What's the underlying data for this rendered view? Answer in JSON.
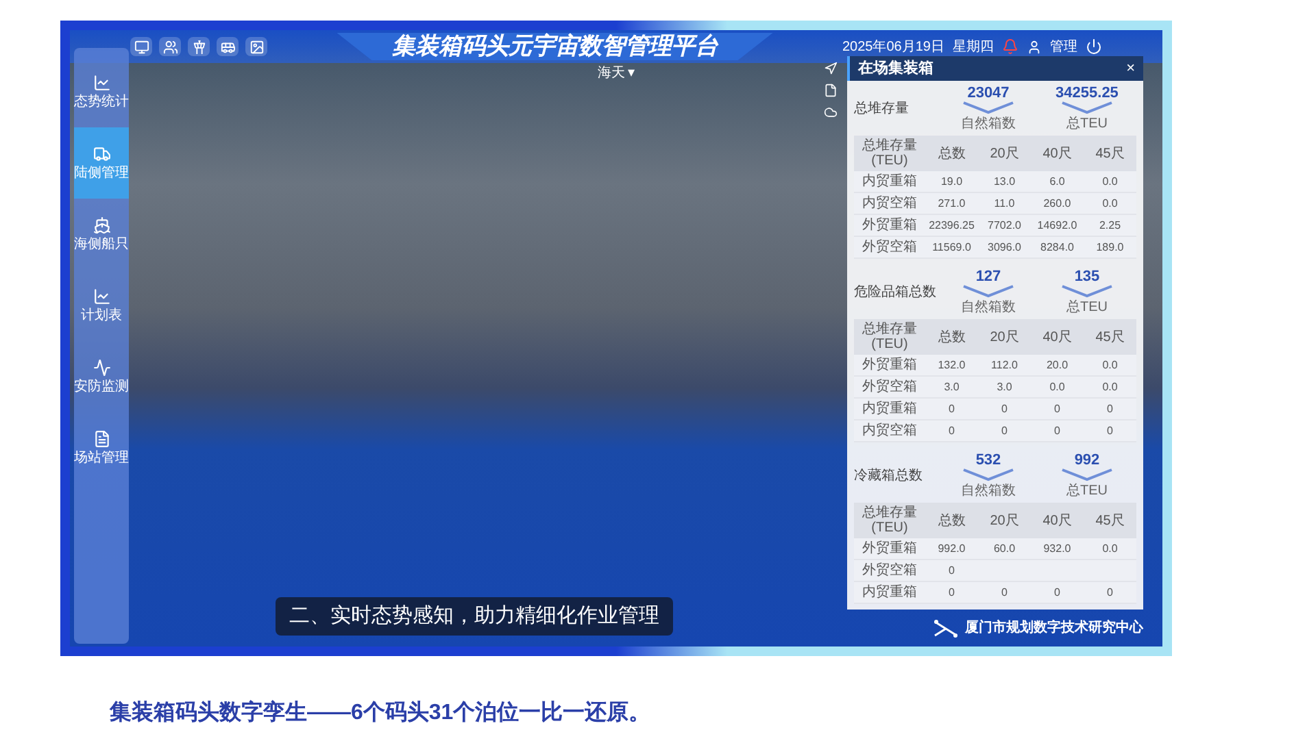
{
  "header": {
    "title": "集装箱码头元宇宙数智管理平台",
    "location": "海天",
    "location_caret": "▾",
    "date": "2025年06月19日",
    "weekday": "星期四",
    "user": "管理"
  },
  "sidebar": {
    "items": [
      {
        "label": "态势统计",
        "selected": false
      },
      {
        "label": "陆侧管理",
        "selected": true
      },
      {
        "label": "海侧船只",
        "selected": false
      },
      {
        "label": "计划表",
        "selected": false
      },
      {
        "label": "安防监测",
        "selected": false
      },
      {
        "label": "场站管理",
        "selected": false
      }
    ]
  },
  "panel": {
    "title": "在场集装箱",
    "close": "×",
    "sections": [
      {
        "label": "总堆存量",
        "stats": [
          {
            "value": "23047",
            "caption": "自然箱数"
          },
          {
            "value": "34255.25",
            "caption": "总TEU"
          }
        ],
        "columns": [
          "总堆存量 (TEU)",
          "总数",
          "20尺",
          "40尺",
          "45尺"
        ],
        "rows": [
          [
            "内贸重箱",
            "19.0",
            "13.0",
            "6.0",
            "0.0"
          ],
          [
            "内贸空箱",
            "271.0",
            "11.0",
            "260.0",
            "0.0"
          ],
          [
            "外贸重箱",
            "22396.25",
            "7702.0",
            "14692.0",
            "2.25"
          ],
          [
            "外贸空箱",
            "11569.0",
            "3096.0",
            "8284.0",
            "189.0"
          ]
        ]
      },
      {
        "label": "危险品箱总数",
        "stats": [
          {
            "value": "127",
            "caption": "自然箱数"
          },
          {
            "value": "135",
            "caption": "总TEU"
          }
        ],
        "columns": [
          "总堆存量 (TEU)",
          "总数",
          "20尺",
          "40尺",
          "45尺"
        ],
        "rows": [
          [
            "外贸重箱",
            "132.0",
            "112.0",
            "20.0",
            "0.0"
          ],
          [
            "外贸空箱",
            "3.0",
            "3.0",
            "0.0",
            "0.0"
          ],
          [
            "内贸重箱",
            "0",
            "0",
            "0",
            "0"
          ],
          [
            "内贸空箱",
            "0",
            "0",
            "0",
            "0"
          ]
        ]
      },
      {
        "label": "冷藏箱总数",
        "stats": [
          {
            "value": "532",
            "caption": "自然箱数"
          },
          {
            "value": "992",
            "caption": "总TEU"
          }
        ],
        "columns": [
          "总堆存量 (TEU)",
          "总数",
          "20尺",
          "40尺",
          "45尺"
        ],
        "rows": [
          [
            "外贸重箱",
            "992.0",
            "60.0",
            "932.0",
            "0.0"
          ],
          [
            "外贸空箱",
            "0"
          ],
          [
            "内贸重箱",
            "0",
            "0",
            "0",
            "0"
          ]
        ]
      }
    ]
  },
  "subtitle": "二、实时态势感知，助力精细化作业管理",
  "logo": {
    "name": "厦门市规划数字技术研究中心"
  },
  "caption": "集装箱码头数字孪生——6个码头31个泊位一比一还原。"
}
